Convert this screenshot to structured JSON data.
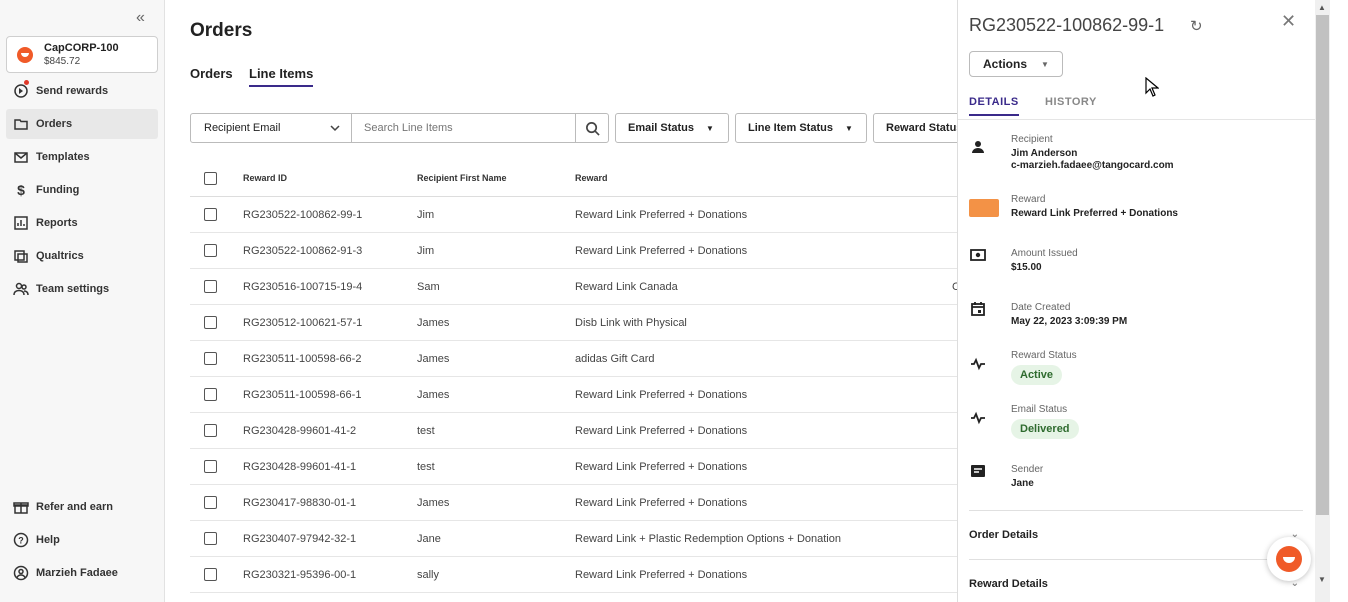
{
  "sidebar": {
    "account": {
      "name": "CapCORP-100",
      "balance": "$845.72"
    },
    "items": [
      {
        "label": "Send rewards",
        "icon": "send-rewards-icon"
      },
      {
        "label": "Orders",
        "icon": "folder-icon",
        "active": true
      },
      {
        "label": "Templates",
        "icon": "mail-icon"
      },
      {
        "label": "Funding",
        "icon": "dollar-icon"
      },
      {
        "label": "Reports",
        "icon": "chart-icon"
      },
      {
        "label": "Qualtrics",
        "icon": "qualtrics-icon"
      },
      {
        "label": "Team settings",
        "icon": "team-icon"
      }
    ],
    "bottom": [
      {
        "label": "Refer and earn",
        "icon": "gift-icon"
      },
      {
        "label": "Help",
        "icon": "help-icon"
      },
      {
        "label": "Marzieh Fadaee",
        "icon": "user-icon"
      }
    ]
  },
  "main": {
    "title": "Orders",
    "tabs": [
      "Orders",
      "Line Items"
    ],
    "search": {
      "field": "Recipient Email",
      "placeholder": "Search Line Items"
    },
    "filters": [
      "Email Status",
      "Line Item Status",
      "Reward Status"
    ],
    "columns": [
      "Reward ID",
      "Recipient First Name",
      "Reward"
    ],
    "rows": [
      {
        "id": "RG230522-100862-99-1",
        "name": "Jim",
        "reward": "Reward Link Preferred + Donations"
      },
      {
        "id": "RG230522-100862-91-3",
        "name": "Jim",
        "reward": "Reward Link Preferred + Donations"
      },
      {
        "id": "RG230516-100715-19-4",
        "name": "Sam",
        "reward": "Reward Link Canada",
        "extra": "C"
      },
      {
        "id": "RG230512-100621-57-1",
        "name": "James",
        "reward": "Disb Link with Physical"
      },
      {
        "id": "RG230511-100598-66-2",
        "name": "James",
        "reward": "adidas Gift Card"
      },
      {
        "id": "RG230511-100598-66-1",
        "name": "James",
        "reward": "Reward Link Preferred + Donations"
      },
      {
        "id": "RG230428-99601-41-2",
        "name": "test",
        "reward": "Reward Link Preferred + Donations"
      },
      {
        "id": "RG230428-99601-41-1",
        "name": "test",
        "reward": "Reward Link Preferred + Donations"
      },
      {
        "id": "RG230417-98830-01-1",
        "name": "James",
        "reward": "Reward Link Preferred + Donations"
      },
      {
        "id": "RG230407-97942-32-1",
        "name": "Jane",
        "reward": "Reward Link + Plastic Redemption Options + Donation"
      },
      {
        "id": "RG230321-95396-00-1",
        "name": "sally",
        "reward": "Reward Link Preferred + Donations"
      }
    ]
  },
  "panel": {
    "title": "RG230522-100862-99-1",
    "actions_label": "Actions",
    "tabs": [
      "DETAILS",
      "HISTORY"
    ],
    "recipient": {
      "label": "Recipient",
      "name": "Jim Anderson",
      "email": "c-marzieh.fadaee@tangocard.com"
    },
    "reward": {
      "label": "Reward",
      "value": "Reward Link Preferred + Donations"
    },
    "amount": {
      "label": "Amount Issued",
      "value": "$15.00"
    },
    "date": {
      "label": "Date Created",
      "value": "May 22, 2023 3:09:39 PM"
    },
    "reward_status": {
      "label": "Reward Status",
      "value": "Active"
    },
    "email_status": {
      "label": "Email Status",
      "value": "Delivered"
    },
    "sender": {
      "label": "Sender",
      "value": "Jane"
    },
    "sections": [
      "Order Details",
      "Reward Details"
    ]
  },
  "colors": {
    "accent": "#3a2a8a",
    "brand": "#f05a28",
    "badge_bg": "#e6f4e6",
    "badge_text": "#2e6b2e"
  }
}
